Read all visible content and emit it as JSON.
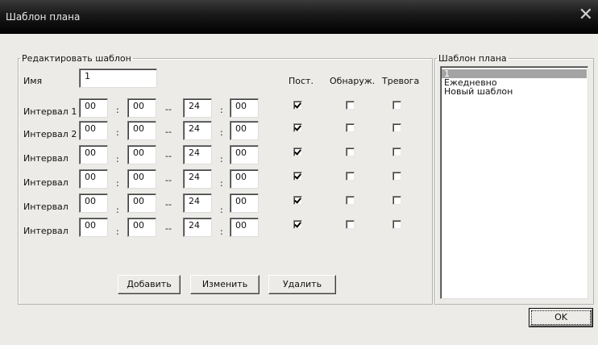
{
  "window": {
    "title": "Шаблон плана",
    "close_glyph": "✕"
  },
  "edit": {
    "legend": "Редактировать шаблон",
    "name_label": "Имя",
    "name_value": "1",
    "col_headers": [
      "Пост.",
      "Обнаруж.",
      "Тревога"
    ],
    "time_sep": ":",
    "range_sep": "--",
    "intervals": [
      {
        "label": "Интервал 1",
        "start_h": "00",
        "start_m": "00",
        "end_h": "24",
        "end_m": "00",
        "post": true,
        "detect": false,
        "alarm": false
      },
      {
        "label": "Интервал 2",
        "start_h": "00",
        "start_m": "00",
        "end_h": "24",
        "end_m": "00",
        "post": true,
        "detect": false,
        "alarm": false
      },
      {
        "label": "Интервал",
        "start_h": "00",
        "start_m": "00",
        "end_h": "24",
        "end_m": "00",
        "post": true,
        "detect": false,
        "alarm": false
      },
      {
        "label": "Интервал",
        "start_h": "00",
        "start_m": "00",
        "end_h": "24",
        "end_m": "00",
        "post": true,
        "detect": false,
        "alarm": false
      },
      {
        "label": "Интервал",
        "start_h": "00",
        "start_m": "00",
        "end_h": "24",
        "end_m": "00",
        "post": true,
        "detect": false,
        "alarm": false
      },
      {
        "label": "Интервал",
        "start_h": "00",
        "start_m": "00",
        "end_h": "24",
        "end_m": "00",
        "post": true,
        "detect": false,
        "alarm": false
      }
    ],
    "buttons": {
      "add": "Добавить",
      "change": "Изменить",
      "delete": "Удалить"
    }
  },
  "templates": {
    "legend": "Шаблон плана",
    "items": [
      "1",
      "Ежедневно",
      "Новый шаблон"
    ],
    "selected": "1"
  },
  "ok_label": "OK"
}
